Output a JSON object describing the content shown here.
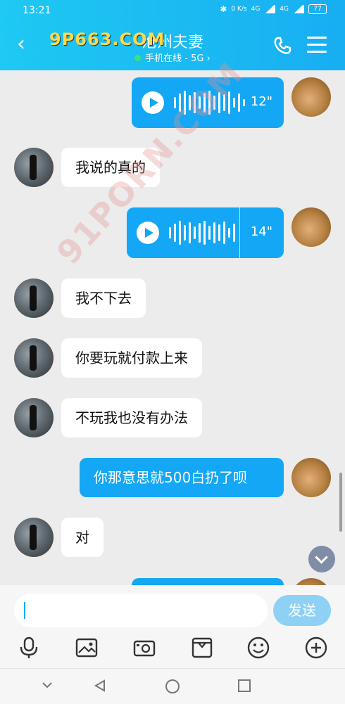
{
  "status_bar": {
    "time": "13:21",
    "speed": "0\nK/s",
    "net1": "4G",
    "net2": "4G",
    "battery": "77"
  },
  "header": {
    "title": "沧州夫妻",
    "subtitle": "手机在线 - 5G",
    "subtitle_arrow": "›",
    "watermark": "9P663.COM"
  },
  "overlay_watermark": "91PORN.COM",
  "messages": [
    {
      "side": "right",
      "type": "voice",
      "duration": "12\""
    },
    {
      "side": "left",
      "type": "text",
      "text": "我说的真的"
    },
    {
      "side": "right",
      "type": "voice",
      "duration": "14\""
    },
    {
      "side": "left",
      "type": "text",
      "text": "我不下去"
    },
    {
      "side": "left",
      "type": "text",
      "text": "你要玩就付款上来"
    },
    {
      "side": "left",
      "type": "text",
      "text": "不玩我也没有办法"
    },
    {
      "side": "right",
      "type": "text",
      "text": "你那意思就500白扔了呗"
    },
    {
      "side": "left",
      "type": "text",
      "text": "对"
    }
  ],
  "input": {
    "placeholder": "",
    "send_label": "发送"
  },
  "toolbar": [
    "mic-icon",
    "image-icon",
    "camera-icon",
    "folder-icon",
    "emoji-icon",
    "plus-icon"
  ],
  "colors": {
    "header": "#18aef2",
    "bubble_right": "#13a7f5",
    "send": "#8fd0f5"
  }
}
